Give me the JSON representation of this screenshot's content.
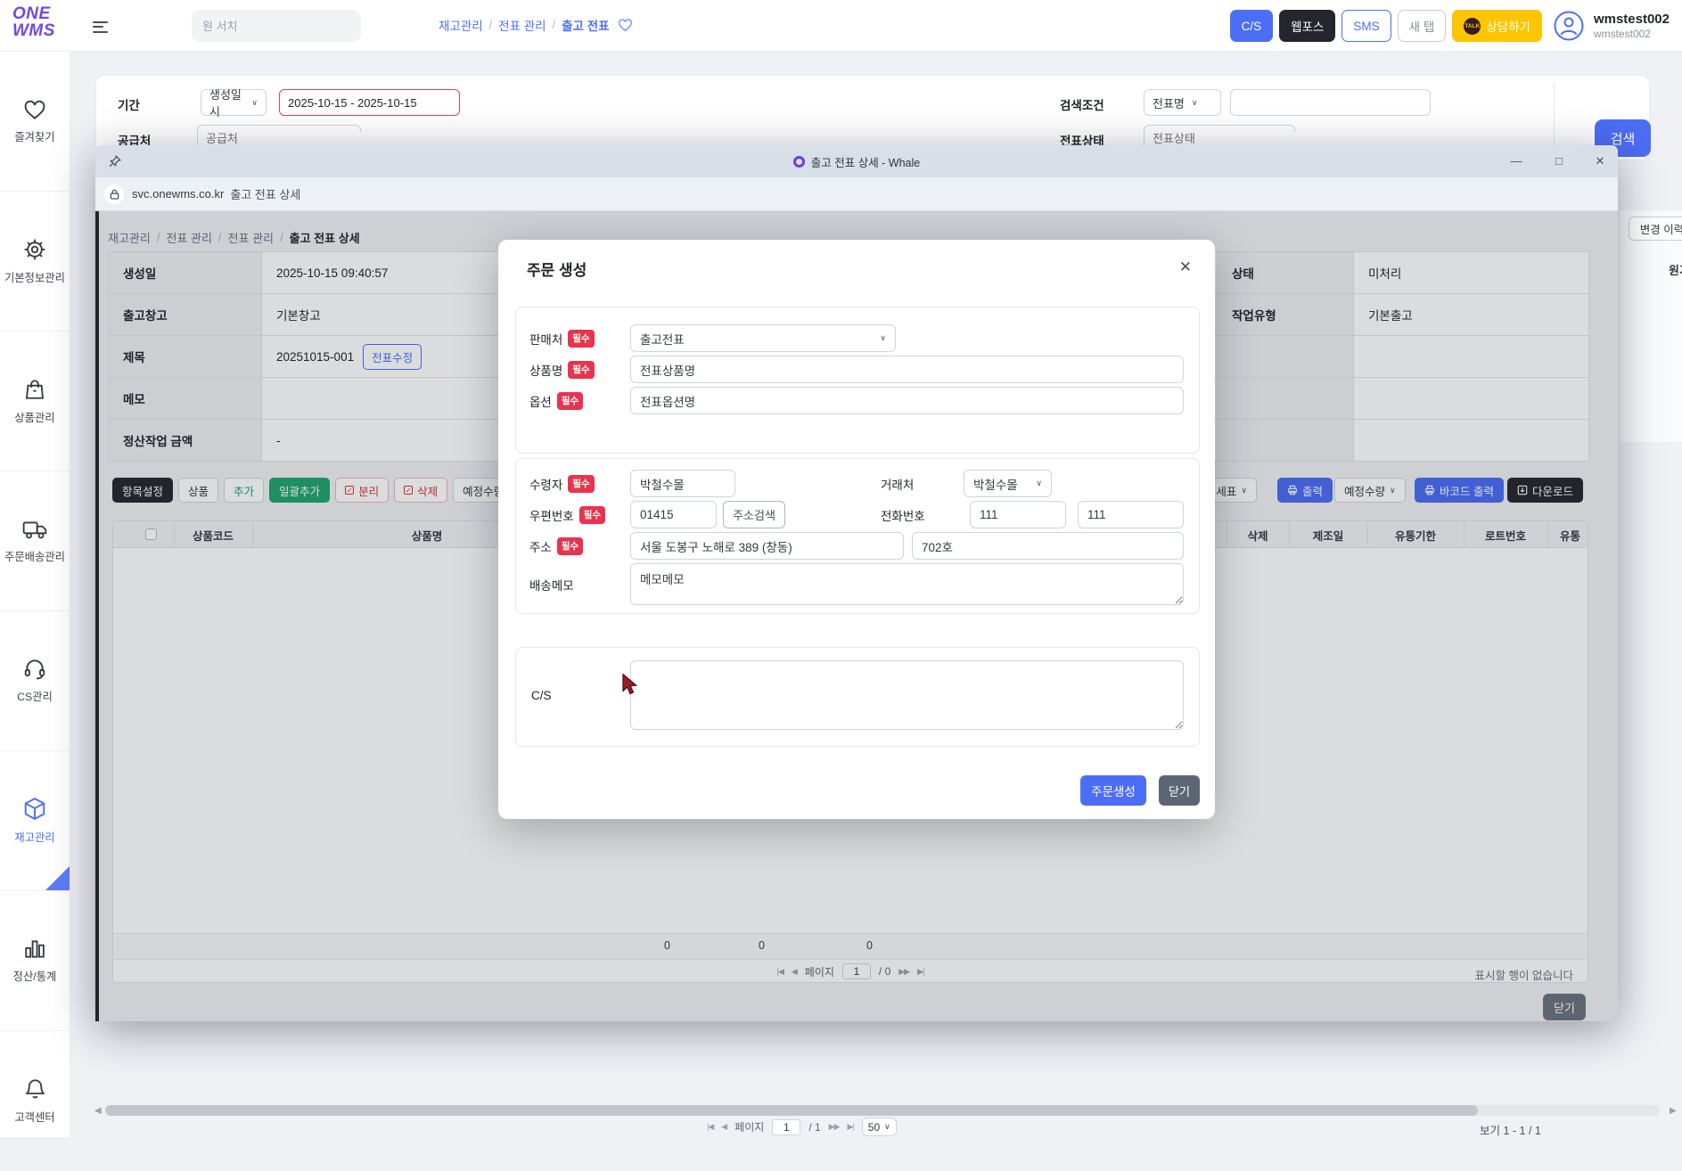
{
  "icons": {
    "sep": "/",
    "chevron": "∨",
    "min": "—",
    "max": "□",
    "close": "✕",
    "pg_first": "|◀",
    "pg_prev": "◀",
    "pg_next": "▶▶",
    "pg_last": "▶|"
  },
  "app": {
    "logo1": "ONE",
    "logo2": "WMS"
  },
  "header": {
    "search_placeholder": "원 서치",
    "bc1": "재고관리",
    "bc2": "전표 관리",
    "bc3": "출고 전표",
    "btn_cs": "C/S",
    "btn_webpos": "웹포스",
    "btn_sms": "SMS",
    "btn_newtab": "새 탭",
    "btn_consult": "상담하기",
    "talk": "TALK",
    "user_name": "wmstest002",
    "user_id": "wmstest002"
  },
  "sidebar": {
    "items": [
      {
        "label": "즐겨찾기"
      },
      {
        "label": "기본정보관리"
      },
      {
        "label": "상품관리"
      },
      {
        "label": "주문배송관리"
      },
      {
        "label": "CS관리"
      },
      {
        "label": "재고관리"
      },
      {
        "label": "정산/통계"
      },
      {
        "label": "고객센터"
      }
    ]
  },
  "filter": {
    "period_label": "기간",
    "period_type": "생성일시",
    "period_value": "2025-10-15 - 2025-10-15",
    "supplier_label": "공급처",
    "supplier_placeholder": "공급처",
    "condition_label": "검색조건",
    "condition_type": "전표명",
    "status_label": "전표상태",
    "status_placeholder": "전표상태",
    "search_button": "검색"
  },
  "fragments": {
    "history_button": "변경 이력",
    "cost_header": "원가"
  },
  "popup": {
    "window_title": "출고 전표 상세 - Whale",
    "url_domain": "svc.onewms.co.kr",
    "url_title": "출고 전표 상세",
    "bc1": "재고관리",
    "bc2": "전표 관리",
    "bc3": "전표 관리",
    "bc4": "출고 전표 상세",
    "d_created_label": "생성일",
    "d_created": "2025-10-15 09:40:57",
    "d_wh_label": "출고창고",
    "d_wh": "기본창고",
    "d_title_label": "제목",
    "d_title": "20251015-001",
    "d_edit": "전표수정",
    "d_memo_label": "메모",
    "d_amount_label": "정산작업 금액",
    "d_amount": "-",
    "d_status_label": "상태",
    "d_status": "미처리",
    "d_worktype_label": "작업유형",
    "d_worktype": "기본출고",
    "tb_settings": "항목설정",
    "tb_product": "상품",
    "tb_add": "추가",
    "tb_bulk": "일괄추가",
    "tb_split": "분리",
    "tb_delete": "삭제",
    "tb_planned": "예정수량",
    "tb_frag": "세표",
    "tb_print": "출력",
    "tb_planned2": "예정수량",
    "tb_barcode": "바코드 출력",
    "tb_download": "다운로드",
    "th_code": "상품코드",
    "th_name": "상품명",
    "th_del": "삭제",
    "th_mfg": "제조일",
    "th_exp": "유통기한",
    "th_lot": "로트번호",
    "th_cut": "유통",
    "sum1": "0",
    "sum2": "0",
    "sum3": "0",
    "pg_label": "페이지",
    "pg_value": "1",
    "pg_total": "/ 0",
    "empty_msg": "표시할 행이 없습니다",
    "close": "닫기"
  },
  "modal": {
    "title": "주문 생성",
    "req": "필수",
    "seller_label": "판매처",
    "seller_value": "출고전표",
    "pname_label": "상품명",
    "pname_value": "전표상품명",
    "option_label": "옵션",
    "option_value": "전표옵션명",
    "receiver_label": "수령자",
    "receiver_value": "박철수몰",
    "client_label": "거래처",
    "client_value": "박철수몰",
    "zip_label": "우편번호",
    "zip_value": "01415",
    "zip_search": "주소검색",
    "phone_label": "전화번호",
    "phone1": "111",
    "phone2": "111",
    "addr_label": "주소",
    "addr1": "서울 도봉구 노해로 389 (창동)",
    "addr2": "702호",
    "memo_label": "배송메모",
    "memo_value": "메모메모",
    "cs_label": "C/S",
    "submit": "주문생성",
    "close": "닫기"
  },
  "footer": {
    "pg_label": "페이지",
    "pg_value": "1",
    "pg_total": "/ 1",
    "page_size": "50",
    "summary": "보기 1 - 1 / 1"
  }
}
